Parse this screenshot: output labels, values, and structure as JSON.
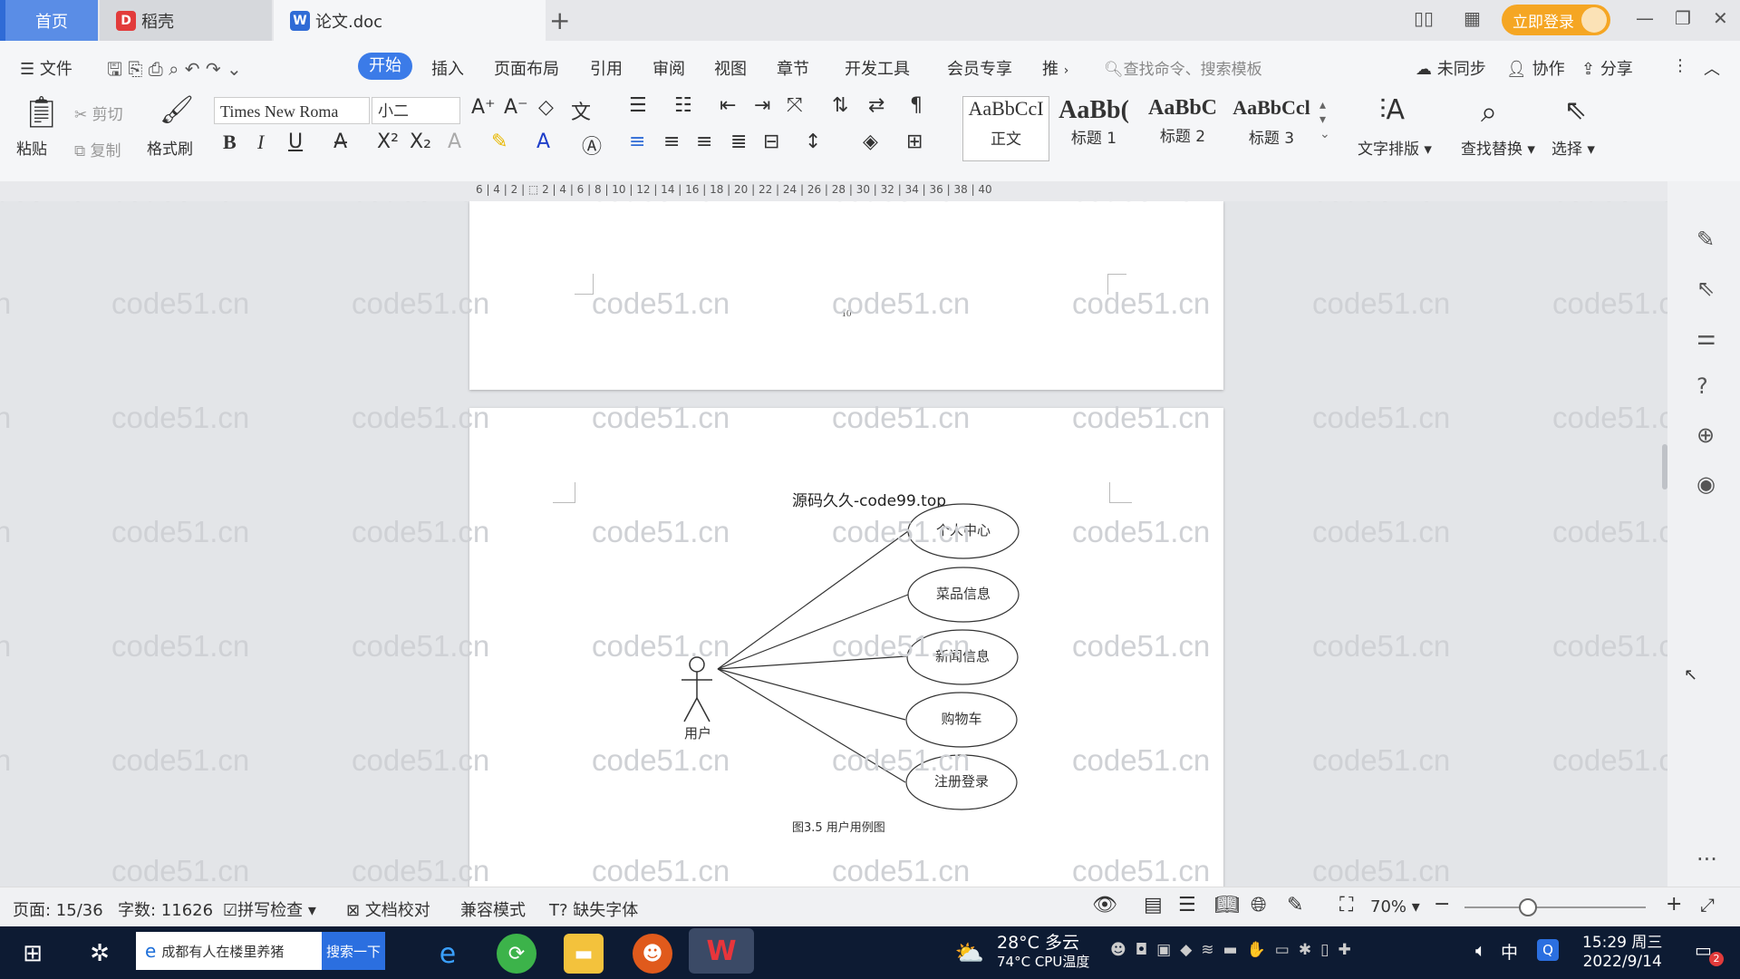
{
  "tabs": {
    "home": "首页",
    "daoke": "稻壳",
    "doc": "论文.doc"
  },
  "login": "立即登录",
  "menu": {
    "file": "文件",
    "items": [
      "开始",
      "插入",
      "页面布局",
      "引用",
      "审阅",
      "视图",
      "章节",
      "开发工具",
      "会员专享",
      "推"
    ],
    "search_cmd": "查找命令、搜索模板",
    "sync": "未同步",
    "collab": "协作",
    "share": "分享"
  },
  "ribbon": {
    "paste": "粘贴",
    "cut": "剪切",
    "copy": "复制",
    "format_painter": "格式刷",
    "font_name": "Times New Roma",
    "font_size": "小二",
    "styles": [
      {
        "sample": "AaBbCcI",
        "name": "正文"
      },
      {
        "sample": "AaBb(",
        "name": "标题 1"
      },
      {
        "sample": "AaBbC",
        "name": "标题 2"
      },
      {
        "sample": "AaBbCcl",
        "name": "标题 3"
      }
    ],
    "text_layout": "文字排版",
    "find_replace": "查找替换",
    "select": "选择"
  },
  "ruler": "6 | 4 | 2 | ⬚ 2 | 4 | 6 | 8 | 10 | 12 | 14 | 16 | 18 | 20 | 22 | 24 | 26 | 28 | 30 | 32 | 34 | 36 | 38 | 40",
  "watermark": "code51.cn",
  "document": {
    "page_number": "10",
    "header_text": "源码久久-code99.top",
    "actor": "用户",
    "use_cases": [
      "个人中心",
      "菜品信息",
      "新闻信息",
      "购物车",
      "注册登录"
    ],
    "caption": "图3.5 用户用例图"
  },
  "status": {
    "page": "页面: 15/36",
    "words": "字数: 11626",
    "spell": "拼写检查",
    "proof": "文档校对",
    "compat": "兼容模式",
    "missing_font": "缺失字体",
    "zoom": "70%"
  },
  "taskbar": {
    "search_text": "成都有人在楼里养猪",
    "search_btn": "搜索一下",
    "weather": "28°C 多云",
    "cpu": "74°C CPU温度",
    "ime": "中",
    "time": "15:29 周三",
    "date": "2022/9/14",
    "notif": "2"
  },
  "colors": {
    "accent": "#3b7be8",
    "login": "#f5a623",
    "home_tab": "#5a8de6",
    "taskbar": "#0d1b33"
  }
}
